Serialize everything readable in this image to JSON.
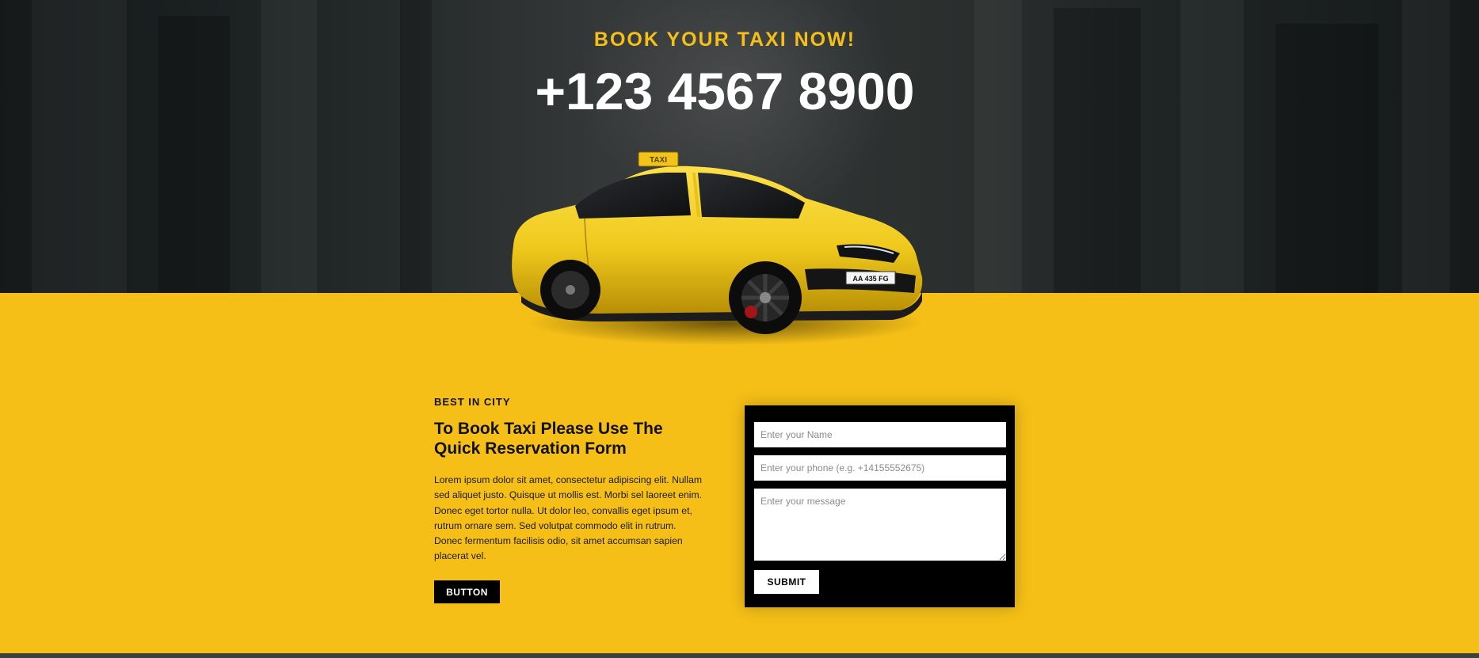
{
  "hero": {
    "title": "BOOK YOUR TAXI NOW!",
    "phone": "+123 4567 8900",
    "car_roof_sign": "TAXI",
    "car_plate": "AA 435 FG"
  },
  "content": {
    "kicker": "BEST IN CITY",
    "heading": "To Book Taxi Please Use The Quick Reservation Form",
    "body": "Lorem ipsum dolor sit amet, consectetur adipiscing elit. Nullam sed aliquet justo. Quisque ut mollis est. Morbi sel laoreet enim. Donec eget tortor nulla. Ut dolor leo, convallis eget ipsum et, rutrum ornare sem. Sed volutpat commodo elit in rutrum. Donec fermentum facilisis odio, sit amet accumsan sapien placerat vel.",
    "button_label": "BUTTON"
  },
  "form": {
    "name_placeholder": "Enter your Name",
    "phone_placeholder": "Enter your phone (e.g. +14155552675)",
    "message_placeholder": "Enter your message",
    "name_value": "",
    "phone_value": "",
    "message_value": "",
    "submit_label": "SUBMIT"
  },
  "colors": {
    "accent_yellow": "#f5bf17",
    "dark": "#000000",
    "hero_dark": "#1b2021"
  }
}
